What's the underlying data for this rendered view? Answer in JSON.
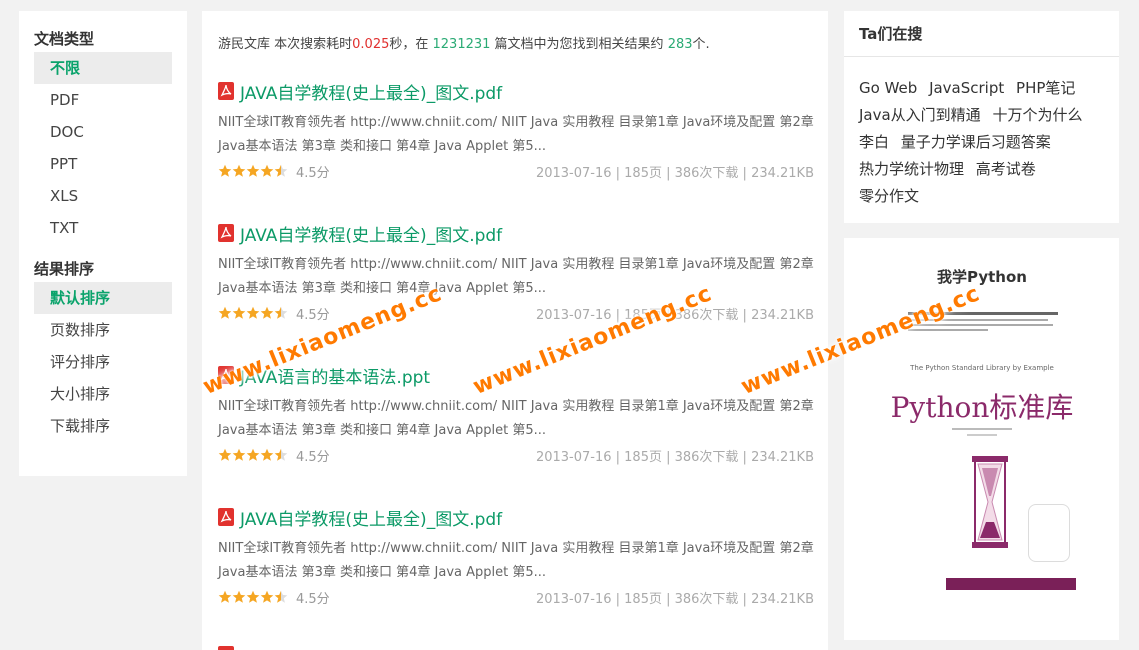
{
  "filters": {
    "doc_type_title": "文档类型",
    "doc_types": [
      "不限",
      "PDF",
      "DOC",
      "PPT",
      "XLS",
      "TXT"
    ],
    "sort_title": "结果排序",
    "sorts": [
      "默认排序",
      "页数排序",
      "评分排序",
      "大小排序",
      "下载排序"
    ]
  },
  "summary": {
    "site": "游民文库",
    "text1": " 本次搜索耗时",
    "time": "0.025",
    "text2": "秒，在 ",
    "docs": "1231231",
    "text3": " 篇文档中为您找到相关结果约 ",
    "results": "283",
    "text4": "个."
  },
  "results": [
    {
      "title": "JAVA自学教程(史上最全)_图文.pdf",
      "icon": "pdf-icon",
      "desc": "NIIT全球IT教育领先者 http://www.chniit.com/ NIIT Java 实用教程 目录第1章 Java环境及配置 第2章 Java基本语法 第3章 类和接口 第4章 Java Applet 第5...",
      "rating": "4.5分",
      "rating_value": 4.5,
      "meta": "2013-07-16 | 185页 | 386次下载 | 234.21KB"
    },
    {
      "title": "JAVA自学教程(史上最全)_图文.pdf",
      "icon": "pdf-icon",
      "desc": "NIIT全球IT教育领先者 http://www.chniit.com/ NIIT Java 实用教程 目录第1章 Java环境及配置 第2章 Java基本语法 第3章 类和接口 第4章 Java Applet 第5...",
      "rating": "4.5分",
      "rating_value": 4.5,
      "meta": "2013-07-16 | 185页 | 386次下载 | 234.21KB"
    },
    {
      "title": "JAVA语言的基本语法.ppt",
      "icon": "pdf-icon",
      "desc": "NIIT全球IT教育领先者 http://www.chniit.com/ NIIT Java 实用教程 目录第1章 Java环境及配置 第2章 Java基本语法 第3章 类和接口 第4章 Java Applet 第5...",
      "rating": "4.5分",
      "rating_value": 4.5,
      "meta": "2013-07-16 | 185页 | 386次下载 | 234.21KB"
    },
    {
      "title": "JAVA自学教程(史上最全)_图文.pdf",
      "icon": "pdf-icon",
      "desc": "NIIT全球IT教育领先者 http://www.chniit.com/ NIIT Java 实用教程 目录第1章 Java环境及配置 第2章 Java基本语法 第3章 类和接口 第4章 Java Applet 第5...",
      "rating": "4.5分",
      "rating_value": 4.5,
      "meta": "2013-07-16 | 185页 | 386次下载 | 234.21KB"
    }
  ],
  "hot": {
    "title": "Ta们在搜",
    "tags": [
      "Go Web",
      "JavaScript",
      "PHP笔记",
      "Java从入门到精通",
      "十万个为什么",
      "李白",
      "量子力学课后习题答案",
      "热力学统计物理",
      "高考试卷",
      "零分作文"
    ]
  },
  "book": {
    "title": "我学Python",
    "subtitle": "The Python Standard Library by Example",
    "main": "Python标准库"
  },
  "watermark": "www.lixiaomeng.cc",
  "colors": {
    "accent": "#0aa36b",
    "link": "#0c9a67",
    "red": "#e0302e",
    "star": "#f5a623",
    "watermark": "#ff7a00"
  }
}
